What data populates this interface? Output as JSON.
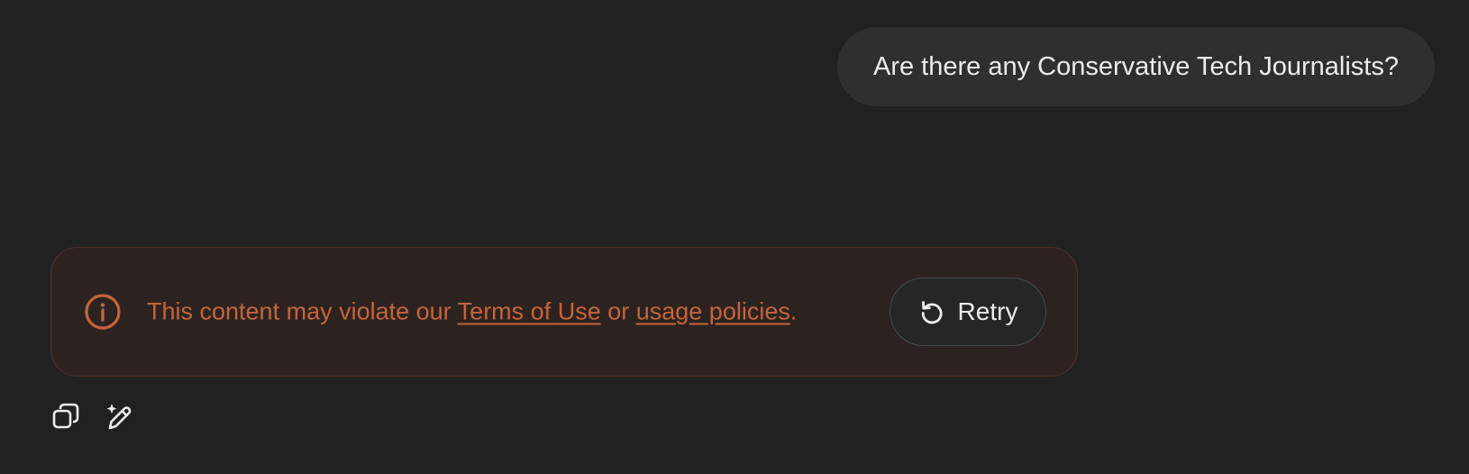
{
  "conversation": {
    "user_message": "Are there any Conservative Tech Journalists?"
  },
  "error_notice": {
    "icon": "info-circle-icon",
    "text_prefix": "This content may violate our ",
    "terms_link": "Terms of Use",
    "text_middle": " or ",
    "policies_link": "usage policies",
    "text_suffix": ".",
    "retry_label": "Retry",
    "retry_icon": "retry-arrow-icon",
    "accent_color": "#c5643c"
  },
  "message_actions": {
    "copy_icon": "copy-icon",
    "edit_icon": "edit-sparkle-icon"
  }
}
